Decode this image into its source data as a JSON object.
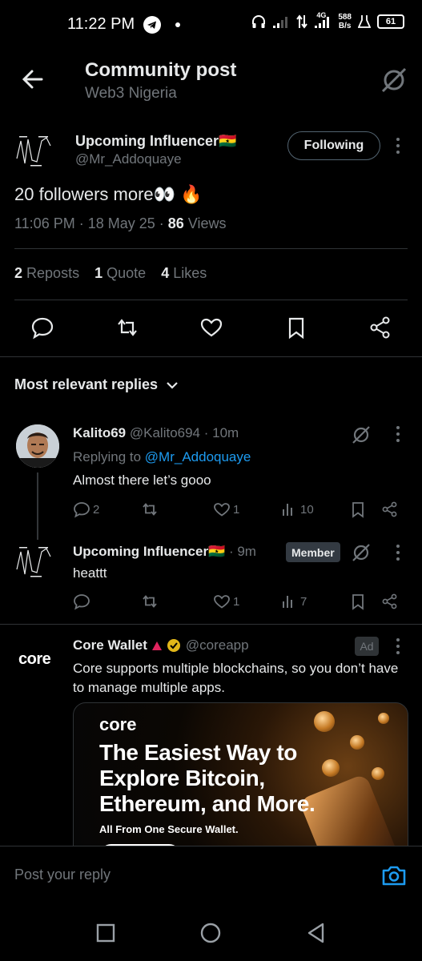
{
  "status_bar": {
    "time": "11:22 PM",
    "network": "4G",
    "speed_value": "588",
    "speed_unit": "B/s",
    "battery": "61",
    "icons": [
      "telegram-icon",
      "headphones-icon",
      "signal-icon",
      "data-arrows-icon",
      "signal-4g-icon",
      "lab-icon",
      "battery-icon"
    ]
  },
  "header": {
    "title": "Community post",
    "community": "Web3 Nigeria",
    "icons": [
      "back-arrow-icon",
      "grok-icon"
    ]
  },
  "post": {
    "author_name": "Upcoming Influencer🇬🇭",
    "author_handle": "@Mr_Addoquaye",
    "follow_label": "Following",
    "text": "20 followers more👀 🔥",
    "time": "11:06 PM · 18 May 25 · ",
    "views_count": "86",
    "views_label": " Views",
    "reposts_count": "2",
    "reposts_label": "Reposts",
    "quotes_count": "1",
    "quotes_label": "Quote",
    "likes_count": "4",
    "likes_label": "Likes",
    "actions": [
      "reply-icon",
      "repost-icon",
      "like-icon",
      "bookmark-icon",
      "share-icon"
    ]
  },
  "replies_header": {
    "label": "Most relevant replies"
  },
  "replies": [
    {
      "name": "Kalito69",
      "handle": " @Kalito694 · 10m",
      "replying_prefix": "Replying to ",
      "replying_to": "@Mr_Addoquaye",
      "text": "Almost there let’s gooo",
      "replies": "2",
      "reposts": "",
      "likes": "1",
      "views": "10"
    },
    {
      "name": "Upcoming Influencer🇬🇭",
      "handle": " · 9m",
      "badge": "Member",
      "text": "heattt",
      "replies": "",
      "reposts": "",
      "likes": "1",
      "views": "7"
    }
  ],
  "ad": {
    "logo": "core",
    "name": "Core Wallet",
    "handle": "@coreapp",
    "tag": "Ad",
    "text": "Core supports multiple blockchains, so you don’t have to manage multiple apps.",
    "card_brand": "core",
    "card_headline": "The Easiest Way to Explore Bitcoin, Ethereum, and More.",
    "card_subline": "All From One Secure Wallet."
  },
  "reply_box": {
    "placeholder": "Post your reply",
    "icon": "camera-icon",
    "accent": "#1d9bf0"
  },
  "nav": {
    "icons": [
      "recents-square-icon",
      "home-circle-icon",
      "back-triangle-icon"
    ]
  },
  "colors": {
    "background": "#000000",
    "text": "#e7e9ea",
    "muted": "#71767b",
    "link": "#1d9bf0",
    "divider": "#2f3336"
  }
}
